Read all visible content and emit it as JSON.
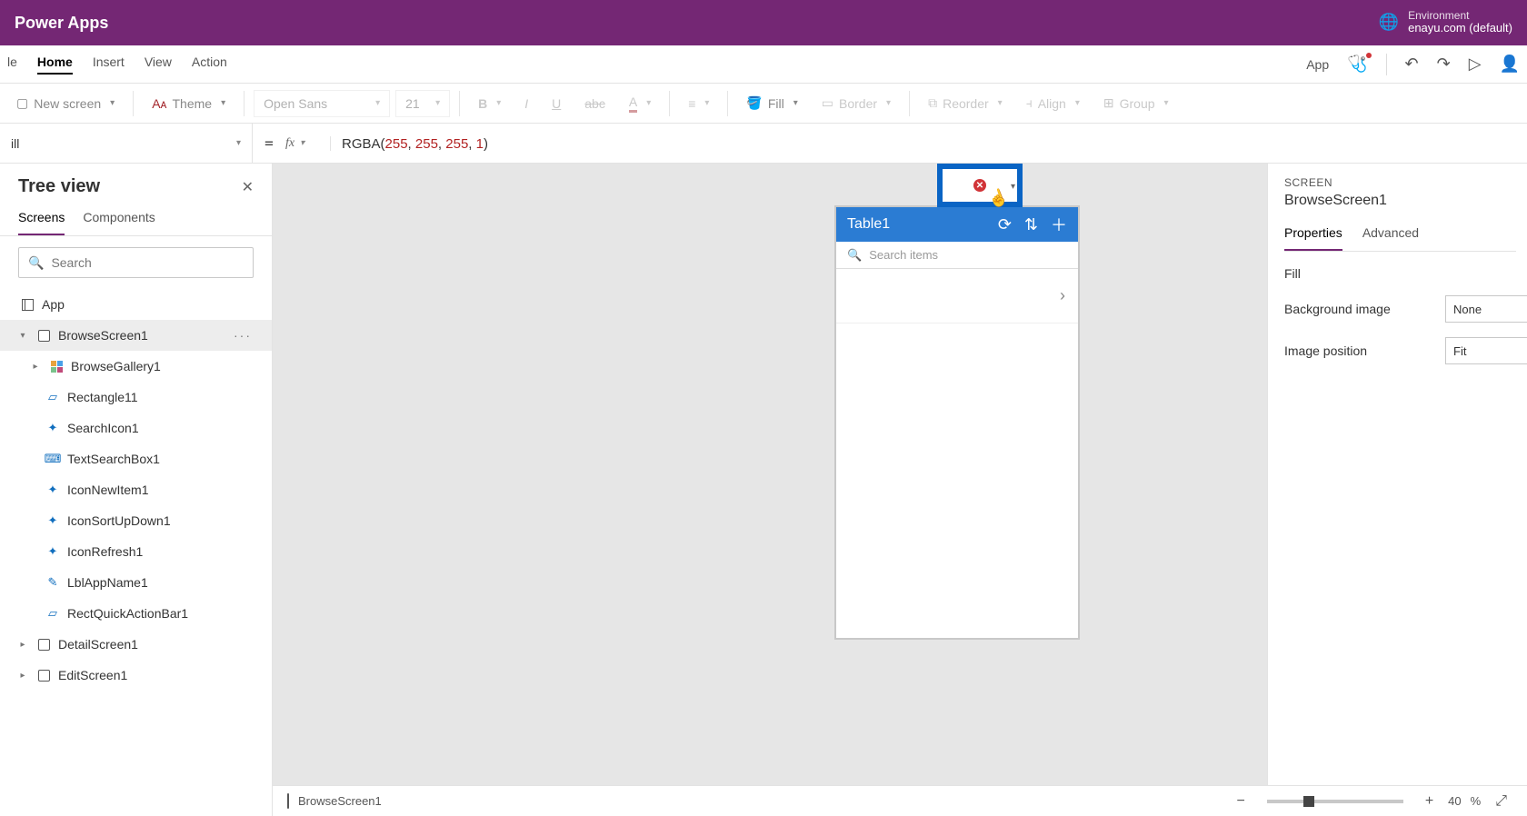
{
  "suite": {
    "title": "Power Apps",
    "env_label": "Environment",
    "env_name": "enayu.com (default)"
  },
  "menu": {
    "tabs": [
      "le",
      "Home",
      "Insert",
      "View",
      "Action"
    ],
    "active": "Home",
    "app_button": "App"
  },
  "toolbar": {
    "new_screen": "New screen",
    "theme": "Theme",
    "font": "Open Sans",
    "font_size": "21",
    "fill": "Fill",
    "border": "Border",
    "reorder": "Reorder",
    "align": "Align",
    "group": "Group"
  },
  "formula": {
    "property": "ill",
    "fn": "RGBA",
    "args": [
      "255",
      "255",
      "255",
      "1"
    ]
  },
  "tree": {
    "title": "Tree view",
    "tabs": [
      "Screens",
      "Components"
    ],
    "active_tab": "Screens",
    "search_placeholder": "Search",
    "app_label": "App",
    "nodes": [
      {
        "name": "BrowseScreen1",
        "type": "screen",
        "expanded": true,
        "selected": true,
        "children": [
          {
            "name": "BrowseGallery1",
            "type": "gallery"
          },
          {
            "name": "Rectangle11",
            "type": "shape"
          },
          {
            "name": "SearchIcon1",
            "type": "icon"
          },
          {
            "name": "TextSearchBox1",
            "type": "textinput"
          },
          {
            "name": "IconNewItem1",
            "type": "icon"
          },
          {
            "name": "IconSortUpDown1",
            "type": "icon"
          },
          {
            "name": "IconRefresh1",
            "type": "icon"
          },
          {
            "name": "LblAppName1",
            "type": "label"
          },
          {
            "name": "RectQuickActionBar1",
            "type": "shape"
          }
        ]
      },
      {
        "name": "DetailScreen1",
        "type": "screen"
      },
      {
        "name": "EditScreen1",
        "type": "screen"
      }
    ]
  },
  "canvas": {
    "app_title": "Table1",
    "search_placeholder": "Search items"
  },
  "props": {
    "category": "SCREEN",
    "name": "BrowseScreen1",
    "tabs": [
      "Properties",
      "Advanced"
    ],
    "active_tab": "Properties",
    "rows": [
      {
        "label": "Fill",
        "value": ""
      },
      {
        "label": "Background image",
        "value": "None"
      },
      {
        "label": "Image position",
        "value": "Fit"
      }
    ]
  },
  "status": {
    "screen": "BrowseScreen1",
    "zoom_pct": "40",
    "pct_suffix": "%"
  }
}
